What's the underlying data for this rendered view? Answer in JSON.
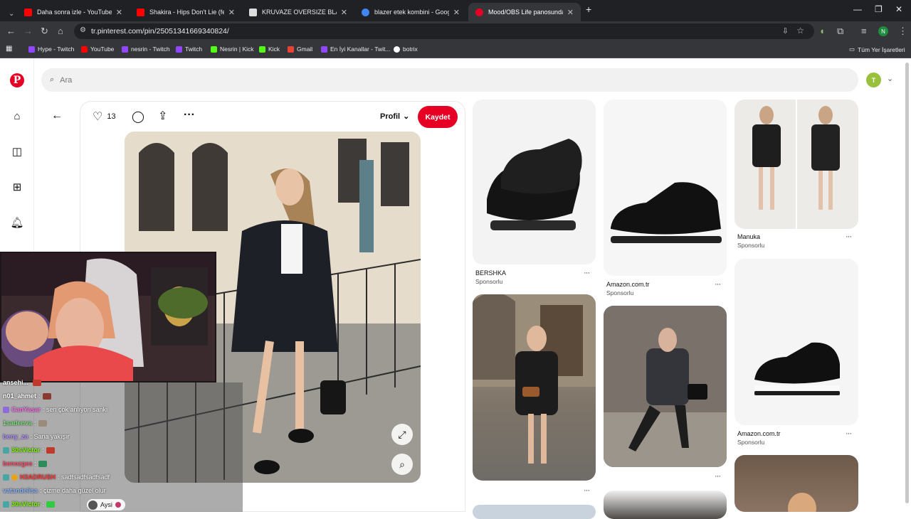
{
  "browser": {
    "tabs": [
      {
        "title": "Daha sonra izle - YouTube",
        "fav_color": "#ff0000"
      },
      {
        "title": "Shakira - Hips Don't Lie (featuri",
        "fav_color": "#ff0000"
      },
      {
        "title": "KRUVAZE OVERSIZE BLAZER - M",
        "fav_color": "#dddddd"
      },
      {
        "title": "blazer etek kombini - Google'da",
        "fav_color": "#4285f4"
      },
      {
        "title": "Mood/OBS Life panosundaki Pi",
        "fav_color": "#e60023"
      }
    ],
    "url": "tr.pinterest.com/pin/25051341669340824/",
    "bookmarks": [
      {
        "label": "Hype - Twitch",
        "color": "#9146ff"
      },
      {
        "label": "YouTube",
        "color": "#ff0000"
      },
      {
        "label": "nesrin - Twitch",
        "color": "#9146ff"
      },
      {
        "label": "Twitch",
        "color": "#9146ff"
      },
      {
        "label": "Nesrin | Kick",
        "color": "#53fc18"
      },
      {
        "label": "Kick",
        "color": "#53fc18"
      },
      {
        "label": "Gmail",
        "color": "#ea4335"
      },
      {
        "label": "En İyi Kanallar - Twit...",
        "color": "#9146ff"
      },
      {
        "label": "botrix",
        "color": "#ffffff"
      }
    ],
    "all_bookmarks": "Tüm Yer İşaretleri",
    "profile_initial": "N"
  },
  "pinterest": {
    "search_placeholder": "Ara",
    "user_initial": "T",
    "pin": {
      "like_count": "13",
      "profile_label": "Profil",
      "save_label": "Kaydet"
    },
    "grid": [
      {
        "brand": "BERSHKA",
        "sub": "Sponsorlu"
      },
      {
        "brand": "Amazon.com.tr",
        "sub": "Sponsorlu"
      },
      {
        "brand": "Manuka",
        "sub": "Sponsorlu"
      },
      {
        "brand": "Amazon.com.tr",
        "sub": "Sponsorlu"
      }
    ]
  },
  "chat": [
    {
      "name": "ansehi...",
      "msg": "",
      "name_color": "#ffffff"
    },
    {
      "name": "n01_ahmet",
      "msg": ":",
      "name_color": "#ffffff"
    },
    {
      "name": "CanYasar",
      "msg": ": sen çok anlıyon sanki",
      "name_color": "#ff6ef0"
    },
    {
      "name": "1sadenva",
      "msg": ":",
      "name_color": "#7be07b"
    },
    {
      "name": "beny_za",
      "msg": ": Sana yakışır",
      "name_color": "#b18cff"
    },
    {
      "name": "30sVictor",
      "msg": ":",
      "name_color": "#7cfc00"
    },
    {
      "name": "benozges",
      "msg": ":",
      "name_color": "#ff4d6d"
    },
    {
      "name": "H3ADRUSH",
      "msg": ": sadfsadfsadfsadf",
      "name_color": "#ff3a3a"
    },
    {
      "name": "vatandelisa",
      "msg": ": çizme daha güzel olur",
      "name_color": "#8ab4ff"
    },
    {
      "name": "30sVictor",
      "msg": ":",
      "name_color": "#7cfc00"
    }
  ],
  "chat_viewer": "Aysi"
}
